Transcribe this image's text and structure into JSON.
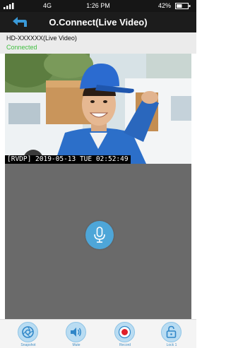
{
  "status_bar": {
    "network": "4G",
    "time": "1:26 PM",
    "battery": "42%"
  },
  "nav": {
    "title": "O.Connect(Live Video)"
  },
  "device": {
    "name": "HD-XXXXXX(Live Video)",
    "status": "Connected"
  },
  "video": {
    "timestamp": "[RVDP] 2019-05-13 TUE 02:52:49"
  },
  "toolbar": {
    "items": [
      {
        "label": "Snapshot",
        "icon": "camera-shutter-icon"
      },
      {
        "label": "Mute",
        "icon": "speaker-icon"
      },
      {
        "label": "Record",
        "icon": "record-icon"
      },
      {
        "label": "Lock 1",
        "icon": "unlock-icon"
      }
    ]
  },
  "colors": {
    "connected": "#3fbf3f",
    "accent": "#4ea6d8",
    "record": "#e0202a"
  }
}
